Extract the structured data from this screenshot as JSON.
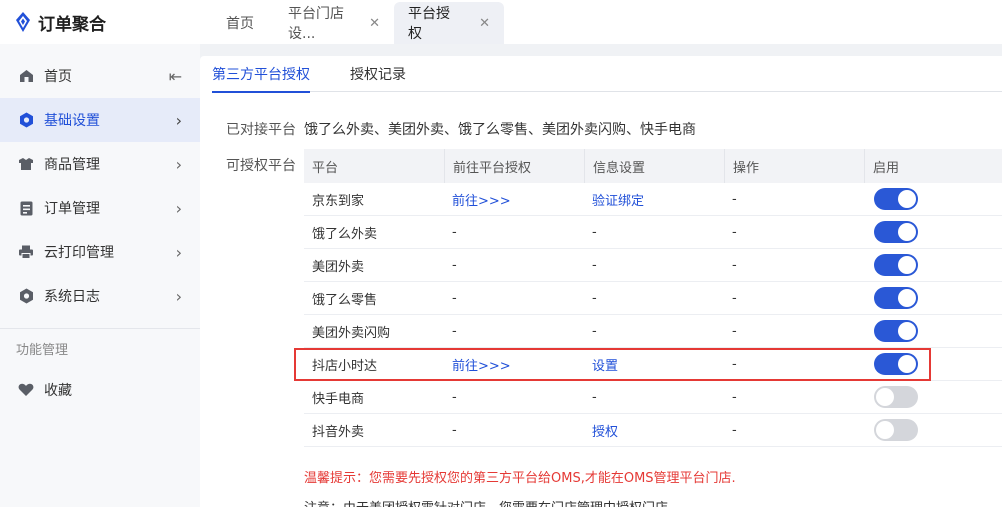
{
  "app": {
    "title": "订单聚合",
    "accent": "#2150d8"
  },
  "tabs": [
    {
      "label": "首页",
      "closable": false,
      "active": false
    },
    {
      "label": "平台门店设...",
      "closable": true,
      "active": false
    },
    {
      "label": "平台授权",
      "closable": true,
      "active": true
    }
  ],
  "sidebar": {
    "items": [
      {
        "label": "首页",
        "icon": "home-icon",
        "arrow": "⇤",
        "active": false
      },
      {
        "label": "基础设置",
        "icon": "settings-icon",
        "arrow": "›",
        "active": true
      },
      {
        "label": "商品管理",
        "icon": "product-icon",
        "arrow": "›",
        "active": false
      },
      {
        "label": "订单管理",
        "icon": "order-icon",
        "arrow": "›",
        "active": false
      },
      {
        "label": "云打印管理",
        "icon": "printer-icon",
        "arrow": "›",
        "active": false
      },
      {
        "label": "系统日志",
        "icon": "log-icon",
        "arrow": "›",
        "active": false
      }
    ],
    "group_title": "功能管理",
    "favorites_label": "收藏"
  },
  "subtabs": [
    {
      "label": "第三方平台授权",
      "active": true
    },
    {
      "label": "授权记录",
      "active": false
    }
  ],
  "connected": {
    "label": "已对接平台",
    "value": "饿了么外卖、美团外卖、饿了么零售、美团外卖闪购、快手电商"
  },
  "authorizable": {
    "label": "可授权平台",
    "columns": [
      "平台",
      "前往平台授权",
      "信息设置",
      "操作",
      "启用"
    ],
    "rows": [
      {
        "platform": "京东到家",
        "goto": "前往>>>",
        "info": "验证绑定",
        "op": "-",
        "enabled": true
      },
      {
        "platform": "饿了么外卖",
        "goto": "-",
        "info": "-",
        "op": "-",
        "enabled": true
      },
      {
        "platform": "美团外卖",
        "goto": "-",
        "info": "-",
        "op": "-",
        "enabled": true
      },
      {
        "platform": "饿了么零售",
        "goto": "-",
        "info": "-",
        "op": "-",
        "enabled": true
      },
      {
        "platform": "美团外卖闪购",
        "goto": "-",
        "info": "-",
        "op": "-",
        "enabled": true
      },
      {
        "platform": "抖店小时达",
        "goto": "前往>>>",
        "info": "设置",
        "op": "-",
        "enabled": true
      },
      {
        "platform": "快手电商",
        "goto": "-",
        "info": "-",
        "op": "-",
        "enabled": false
      },
      {
        "platform": "抖音外卖",
        "goto": "-",
        "info": "授权",
        "op": "-",
        "enabled": false
      }
    ]
  },
  "tip": "温馨提示：您需要先授权您的第三方平台给OMS,才能在OMS管理平台门店.",
  "note": "注意：由于美团授权需针对门店，您需要在门店管理中授权门店"
}
